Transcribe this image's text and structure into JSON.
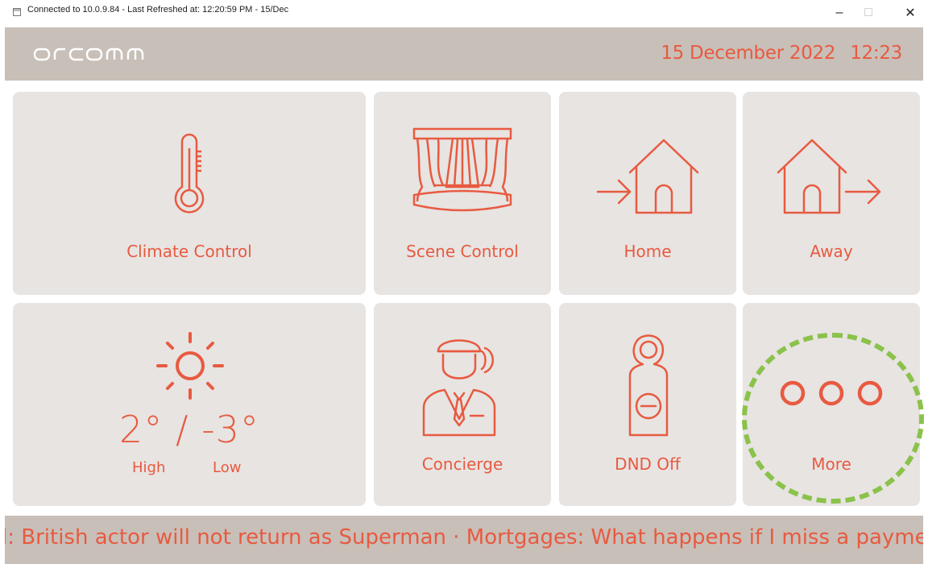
{
  "window": {
    "title": "Connected to 10.0.9.84 - Last Refreshed at: 12:20:59 PM - 15/Dec",
    "controls": {
      "minimize": "–",
      "maximize": "□",
      "close": "✕"
    }
  },
  "header": {
    "logo_text": "orcomm",
    "date": "15 December 2022",
    "time": "12:23"
  },
  "tiles": [
    {
      "label": "Climate Control",
      "icon": "thermometer-icon"
    },
    {
      "label": "Scene Control",
      "icon": "curtain-stage-icon"
    },
    {
      "label": "Home",
      "icon": "home-enter-icon"
    },
    {
      "label": "Away",
      "icon": "home-leave-icon"
    },
    {
      "label": "Concierge",
      "icon": "concierge-icon"
    },
    {
      "label": "DND Off",
      "icon": "door-hanger-icon"
    },
    {
      "label": "More",
      "icon": "more-dots-icon"
    }
  ],
  "weather": {
    "high": "2°",
    "separator": "/",
    "low": "-3°",
    "high_label": "High",
    "low_label": "Low",
    "icon": "sun-icon"
  },
  "ticker": {
    "text": "l: British actor will not return as Superman  ·  Mortgages: What happens if I miss a paymer"
  },
  "colors": {
    "accent": "#e85a40",
    "header_bg": "#c8bfb8",
    "tile_bg": "#e7e4e2",
    "highlight": "#8bc24a"
  }
}
